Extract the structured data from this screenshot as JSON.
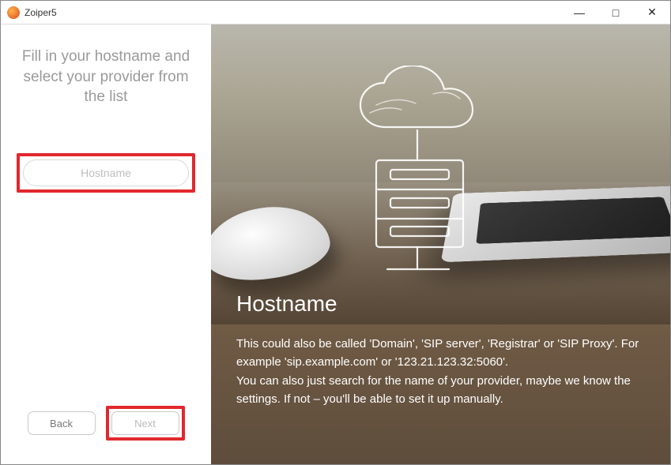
{
  "window": {
    "title": "Zoiper5"
  },
  "left": {
    "instruction": "Fill in your hostname and select your provider from the list",
    "hostname_placeholder": "Hostname",
    "back_label": "Back",
    "next_label": "Next"
  },
  "right": {
    "heading": "Hostname",
    "para1": " This could also be called 'Domain', 'SIP server', 'Registrar' or 'SIP Proxy'. For example 'sip.example.com' or '123.21.123.32:5060'.",
    "para2": "You can also just search for the name of your provider, maybe we know the settings. If not – you'll be able to set it up manually."
  }
}
